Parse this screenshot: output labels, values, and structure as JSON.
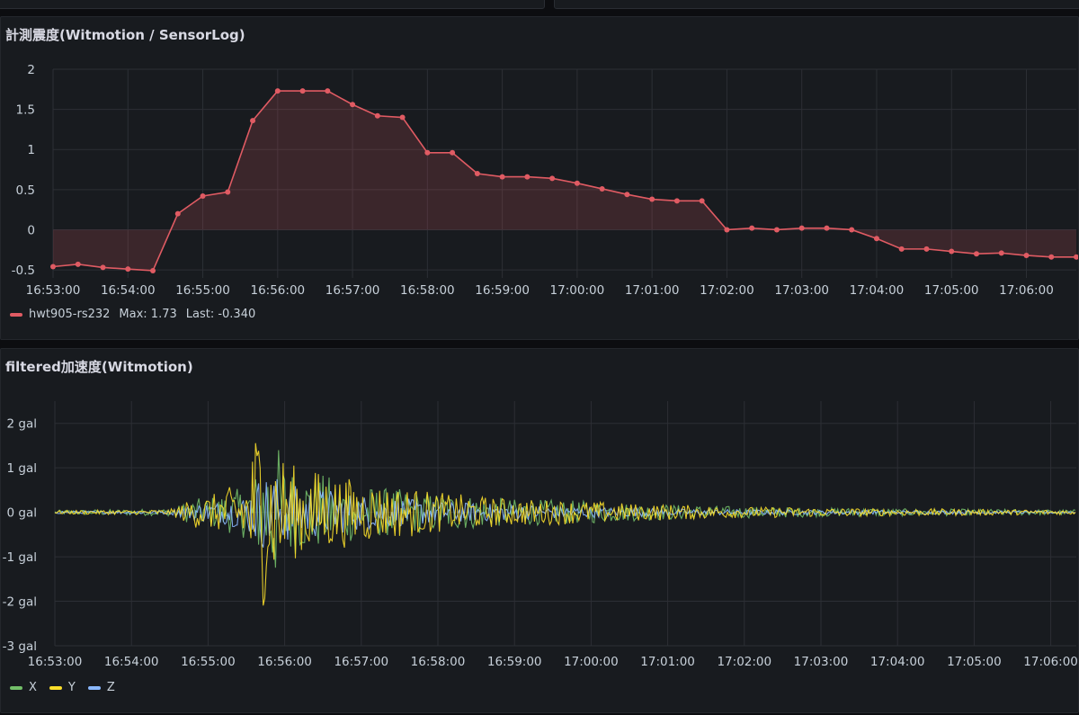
{
  "colors": {
    "background": "#0c0d10",
    "panel": "#181b1f",
    "grid": "#2c2f35",
    "series_red": "#e05b63",
    "series_x": "#73bf69",
    "series_y": "#fade2a",
    "series_z": "#8ab8ff"
  },
  "panels": {
    "seismic": {
      "title": "計測震度(Witmotion / SensorLog)",
      "legend": {
        "series_name": "hwt905-rs232",
        "max_text": "Max: 1.73",
        "last_text": "Last: -0.340"
      }
    },
    "accel": {
      "title": "filtered加速度(Witmotion)",
      "legend": {
        "x_label": "X",
        "y_label": "Y",
        "z_label": "Z"
      }
    }
  },
  "chart_data": [
    {
      "type": "area",
      "title": "計測震度(Witmotion / SensorLog)",
      "xlabel": "",
      "ylabel": "",
      "x_range": [
        "16:53:00",
        "17:06:40"
      ],
      "ylim": [
        -0.6,
        2.0
      ],
      "y_ticks": [
        2,
        1.5,
        1,
        0.5,
        0,
        -0.5
      ],
      "y_tick_labels": [
        "2",
        "1.5",
        "1",
        "0.5",
        "0",
        "-0.5"
      ],
      "x_ticks": [
        "16:53:00",
        "16:54:00",
        "16:55:00",
        "16:56:00",
        "16:57:00",
        "16:58:00",
        "16:59:00",
        "17:00:00",
        "17:01:00",
        "17:02:00",
        "17:03:00",
        "17:04:00",
        "17:05:00",
        "17:06:00"
      ],
      "grid": true,
      "legend_position": "bottom-left",
      "series": [
        {
          "name": "hwt905-rs232",
          "x": [
            "16:53:00",
            "16:53:20",
            "16:53:40",
            "16:54:00",
            "16:54:20",
            "16:54:40",
            "16:55:00",
            "16:55:20",
            "16:55:40",
            "16:56:00",
            "16:56:20",
            "16:56:40",
            "16:57:00",
            "16:57:20",
            "16:57:40",
            "16:58:00",
            "16:58:20",
            "16:58:40",
            "16:59:00",
            "16:59:20",
            "16:59:40",
            "17:00:00",
            "17:00:20",
            "17:00:40",
            "17:01:00",
            "17:01:20",
            "17:01:40",
            "17:02:00",
            "17:02:20",
            "17:02:40",
            "17:03:00",
            "17:03:20",
            "17:03:40",
            "17:04:00",
            "17:04:20",
            "17:04:40",
            "17:05:00",
            "17:05:20",
            "17:05:40",
            "17:06:00",
            "17:06:20",
            "17:06:40"
          ],
          "values": [
            -0.46,
            -0.43,
            -0.47,
            -0.49,
            -0.51,
            0.2,
            0.42,
            0.47,
            1.36,
            1.73,
            1.73,
            1.73,
            1.56,
            1.42,
            1.4,
            0.96,
            0.96,
            0.7,
            0.66,
            0.66,
            0.64,
            0.58,
            0.51,
            0.44,
            0.38,
            0.36,
            0.36,
            0.0,
            0.02,
            0.0,
            0.02,
            0.02,
            0.0,
            -0.11,
            -0.24,
            -0.24,
            -0.27,
            -0.3,
            -0.29,
            -0.32,
            -0.34,
            -0.34
          ]
        }
      ]
    },
    {
      "type": "line",
      "title": "filtered加速度(Witmotion)",
      "xlabel": "",
      "ylabel": "",
      "x_range": [
        "16:53:00",
        "17:06:20"
      ],
      "ylim": [
        -3,
        2.5
      ],
      "y_ticks": [
        2,
        1,
        0,
        -1,
        -2,
        -3
      ],
      "y_tick_labels": [
        "2 gal",
        "1 gal",
        "0 gal",
        "-1 gal",
        "-2 gal",
        "-3 gal"
      ],
      "x_ticks": [
        "16:53:00",
        "16:54:00",
        "16:55:00",
        "16:56:00",
        "16:57:00",
        "16:58:00",
        "16:59:00",
        "17:00:00",
        "17:01:00",
        "17:02:00",
        "17:03:00",
        "17:04:00",
        "17:05:00",
        "17:06:00"
      ],
      "grid": true,
      "legend_position": "bottom-left",
      "x": [
        "16:53:00",
        "16:53:30",
        "16:54:00",
        "16:54:30",
        "16:54:50",
        "16:55:10",
        "16:55:30",
        "16:55:40",
        "16:55:50",
        "16:56:00",
        "16:56:10",
        "16:56:20",
        "16:56:40",
        "16:57:00",
        "16:57:20",
        "16:57:40",
        "16:58:00",
        "16:58:20",
        "16:58:40",
        "16:59:00",
        "16:59:30",
        "17:00:00",
        "17:00:30",
        "17:01:00",
        "17:01:30",
        "17:02:00",
        "17:02:30",
        "17:03:00",
        "17:03:30",
        "17:04:00",
        "17:04:30",
        "17:05:00",
        "17:05:30",
        "17:06:00",
        "17:06:20"
      ],
      "series": [
        {
          "name": "X",
          "amplitude": [
            0.05,
            0.06,
            0.07,
            0.08,
            0.3,
            0.4,
            0.6,
            1.0,
            1.8,
            1.2,
            0.9,
            0.9,
            0.8,
            0.6,
            0.55,
            0.5,
            0.45,
            0.4,
            0.35,
            0.3,
            0.28,
            0.25,
            0.2,
            0.18,
            0.15,
            0.13,
            0.12,
            0.1,
            0.1,
            0.08,
            0.08,
            0.07,
            0.07,
            0.06,
            0.06
          ]
        },
        {
          "name": "Y",
          "amplitude": [
            0.04,
            0.05,
            0.05,
            0.06,
            0.35,
            0.45,
            0.8,
            2.4,
            1.5,
            1.3,
            1.0,
            1.0,
            0.85,
            0.7,
            0.6,
            0.55,
            0.45,
            0.4,
            0.35,
            0.3,
            0.28,
            0.25,
            0.2,
            0.18,
            0.15,
            0.12,
            0.12,
            0.1,
            0.09,
            0.08,
            0.08,
            0.07,
            0.06,
            0.06,
            0.05
          ]
        },
        {
          "name": "Z",
          "amplitude": [
            0.03,
            0.03,
            0.04,
            0.05,
            0.2,
            0.25,
            0.4,
            0.8,
            0.9,
            0.7,
            0.6,
            0.6,
            0.5,
            0.4,
            0.35,
            0.3,
            0.25,
            0.22,
            0.2,
            0.18,
            0.15,
            0.12,
            0.1,
            0.08,
            0.07,
            0.06,
            0.06,
            0.05,
            0.05,
            0.04,
            0.04,
            0.04,
            0.03,
            0.03,
            0.03
          ]
        }
      ]
    }
  ]
}
